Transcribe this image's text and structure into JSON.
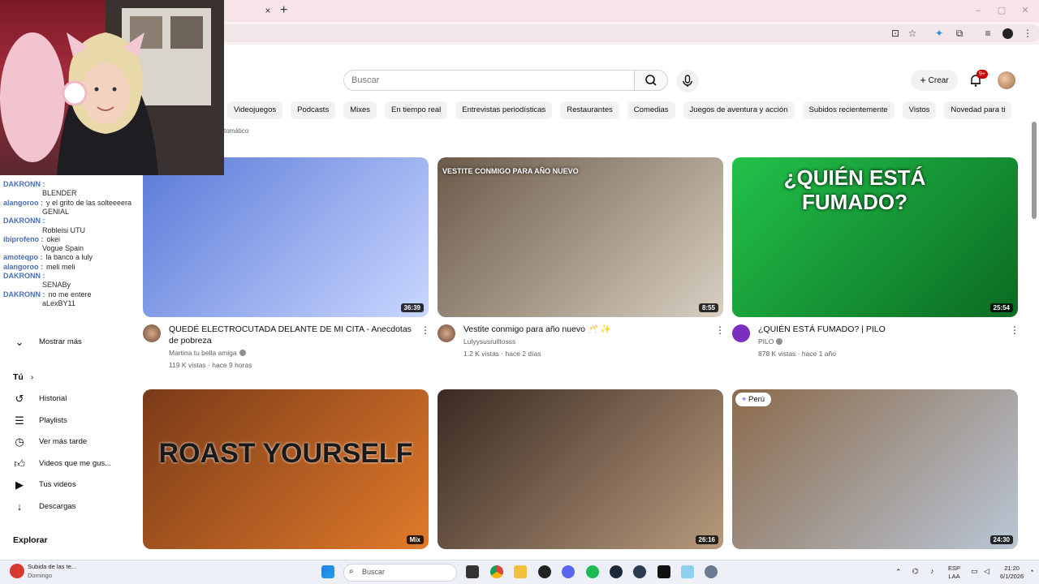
{
  "browser": {
    "tab_close": "×",
    "new_tab": "+",
    "win_minimize": "–",
    "win_maximize": "▢",
    "win_close": "✕",
    "toolbar_icons": [
      "install-icon",
      "star-icon",
      "extension-tool-icon",
      "puzzle-icon",
      "media-icon",
      "profile-icon",
      "more-icon"
    ]
  },
  "header": {
    "search_placeholder": "Buscar",
    "create_label": "Crear",
    "notifications_badge": "9+"
  },
  "chips": [
    "Videojuegos",
    "Podcasts",
    "Mixes",
    "En tiempo real",
    "Entrevistas periodísticas",
    "Restaurantes",
    "Comedias",
    "Juegos de aventura y acción",
    "Subidos recientemente",
    "Vistos",
    "Novedad para ti"
  ],
  "auto_label": "tomático",
  "chat": [
    {
      "user": "DAKRONN :",
      "msg": ""
    },
    {
      "user": "",
      "msg": "BLENDER"
    },
    {
      "user": "alangoroo :",
      "msg": "y el grito de las solteeeera"
    },
    {
      "user": "",
      "msg": "GENIAL"
    },
    {
      "user": "DAKRONN :",
      "msg": ""
    },
    {
      "user": "",
      "msg": "Robleisi UTU"
    },
    {
      "user": "ibiprofeno :",
      "msg": "okei"
    },
    {
      "user": "",
      "msg": "Vogue Spain"
    },
    {
      "user": "amoteqpo :",
      "msg": "la banco a luly"
    },
    {
      "user": "alangoroo :",
      "msg": "meli meli"
    },
    {
      "user": "DAKRONN :",
      "msg": ""
    },
    {
      "user": "",
      "msg": "SENABy"
    },
    {
      "user": "DAKRONN :",
      "msg": "no me entere"
    },
    {
      "user": "",
      "msg": "aLexBY11"
    }
  ],
  "sidebar": {
    "show_more": "Mostrar más",
    "you_heading": "Tú",
    "you_chevron": "›",
    "items": [
      {
        "label": "Historial",
        "icon": "history-icon"
      },
      {
        "label": "Playlists",
        "icon": "playlists-icon"
      },
      {
        "label": "Ver más tarde",
        "icon": "watch-later-icon"
      },
      {
        "label": "Videos que me gus...",
        "icon": "like-icon"
      },
      {
        "label": "Tus videos",
        "icon": "your-videos-icon"
      },
      {
        "label": "Descargas",
        "icon": "downloads-icon"
      }
    ],
    "explore_heading": "Explorar"
  },
  "videos": [
    {
      "title": "QUEDÉ ELECTROCUTADA DELANTE DE MI CITA - Anecdotas de pobreza",
      "channel": "Martina tu bella amiga",
      "verified": true,
      "meta": "119 K vistas · hace 9 horas",
      "duration": "36:39",
      "colors": [
        "#5b7ad8",
        "#c9d7ff"
      ]
    },
    {
      "title": "Vestite conmigo para año nuevo 🥂 ✨",
      "channel": "Lulyysusrulltosss",
      "verified": false,
      "meta": "1.2 K vistas · hace 2 días",
      "duration": "8:55",
      "thumb_text": "VESTITE CONMIGO PARA AÑO NUEVO",
      "colors": [
        "#6b5a48",
        "#d8cfc2"
      ]
    },
    {
      "title": "¿QUIÉN ESTÁ FUMADO? | PILO",
      "channel": "PILO",
      "verified": true,
      "meta": "878 K vistas · hace 1 año",
      "duration": "25:54",
      "thumb_text": "¿QUIÉN ESTÁ FUMADO?",
      "colors": [
        "#22c24a",
        "#0b6b22"
      ]
    },
    {
      "title": "",
      "channel": "",
      "verified": false,
      "meta": "",
      "duration": "Mix",
      "thumb_text": "ROAST YOURSELF",
      "colors": [
        "#7a3a18",
        "#e07a2a"
      ]
    },
    {
      "title": "",
      "channel": "",
      "verified": false,
      "meta": "",
      "duration": "26:16",
      "colors": [
        "#3a2a22",
        "#b79a7c"
      ]
    },
    {
      "title": "",
      "channel": "",
      "verified": false,
      "meta": "",
      "duration": "24:30",
      "location": "Perú",
      "colors": [
        "#8b6a4a",
        "#b9c6d6"
      ]
    }
  ],
  "taskbar": {
    "notification_title": "Subida de las te...",
    "notification_sub": "Domingo",
    "search_label": "Buscar",
    "lang_top": "ESP",
    "lang_bottom": "LAA",
    "time": "21:20",
    "date": "6/1/2026"
  }
}
